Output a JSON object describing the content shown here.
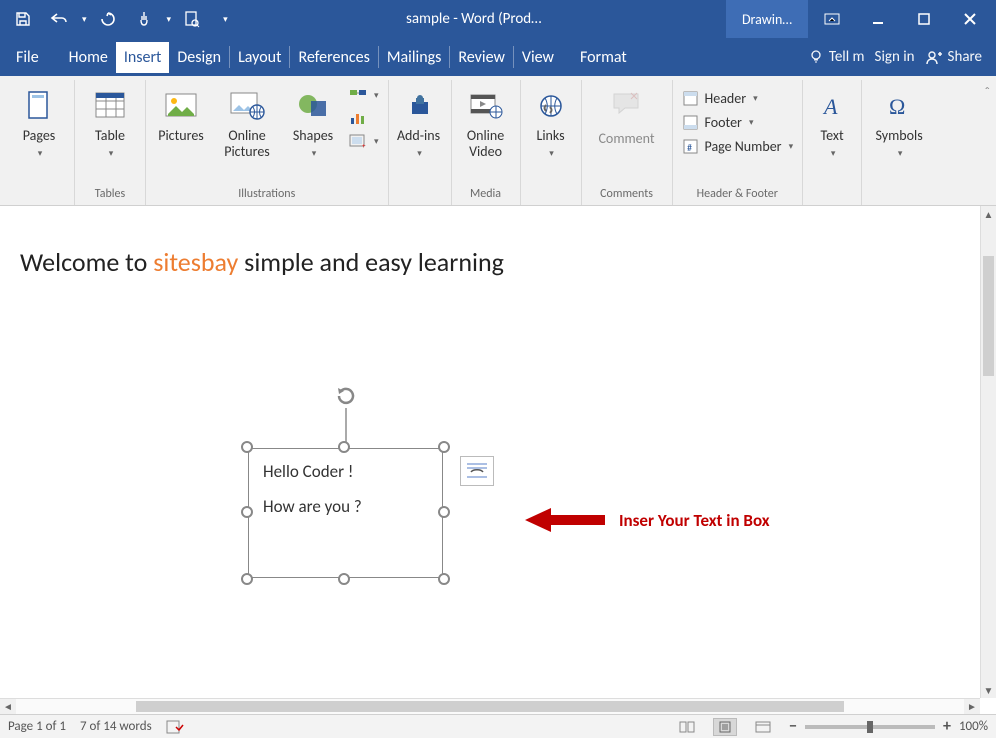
{
  "titlebar": {
    "title": "sample - Word (Prod…",
    "context_tab": "Drawin…"
  },
  "menu": {
    "file": "File",
    "home": "Home",
    "insert": "Insert",
    "design": "Design",
    "layout": "Layout",
    "references": "References",
    "mailings": "Mailings",
    "review": "Review",
    "view": "View",
    "format": "Format",
    "tellme": "Tell m",
    "signin": "Sign in",
    "share": "Share"
  },
  "ribbon": {
    "pages": "Pages",
    "table": "Table",
    "tables_group": "Tables",
    "pictures": "Pictures",
    "online_pictures": "Online Pictures",
    "shapes": "Shapes",
    "illustrations_group": "Illustrations",
    "addins": "Add-ins",
    "online_video": "Online Video",
    "media_group": "Media",
    "links": "Links",
    "comment": "Comment",
    "comments_group": "Comments",
    "header": "Header",
    "footer": "Footer",
    "page_number": "Page Number",
    "hf_group": "Header & Footer",
    "text": "Text",
    "symbols": "Symbols"
  },
  "doc": {
    "heading_pre": "Welcome to ",
    "heading_brand": "sitesbay",
    "heading_post": " simple and easy learning",
    "textbox_line1": "Hello Coder !",
    "textbox_line2": "How are you ?",
    "annotation": "Inser Your Text in Box"
  },
  "status": {
    "page": "Page 1 of 1",
    "words": "7 of 14 words",
    "zoom": "100%"
  }
}
